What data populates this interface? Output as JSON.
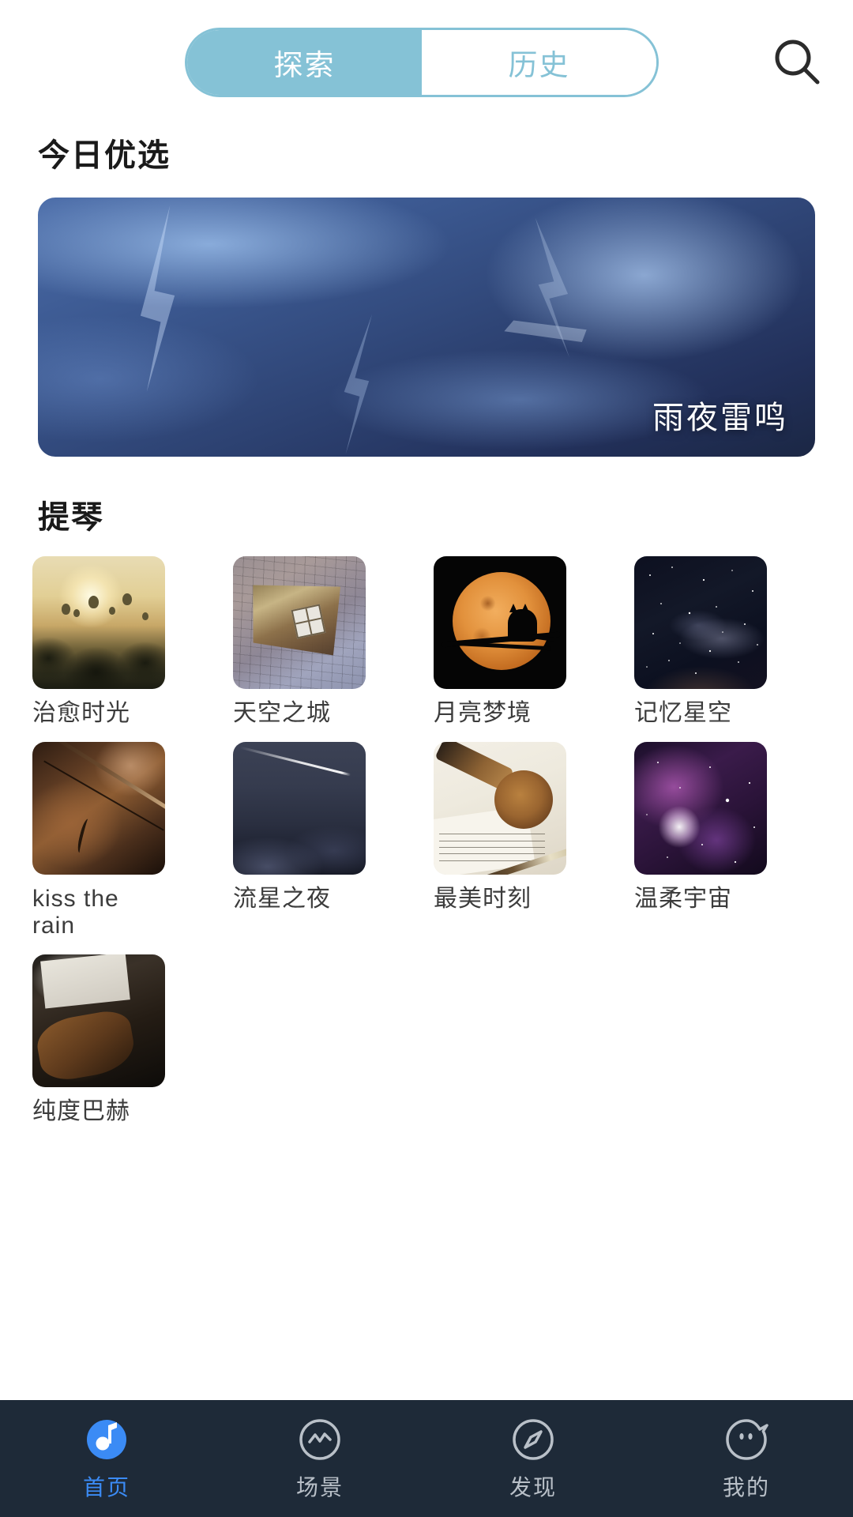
{
  "header": {
    "tabs": [
      {
        "label": "探索",
        "active": true
      },
      {
        "label": "历史",
        "active": false
      }
    ],
    "search_icon": "search-icon",
    "accent_color": "#85c2d6"
  },
  "sections": {
    "today": {
      "title": "今日优选",
      "featured": {
        "label": "雨夜雷鸣",
        "art": "stormy-night-lightning"
      }
    },
    "violin": {
      "title": "提琴",
      "items": [
        {
          "label": "治愈时光",
          "art": "sunrise-balloons"
        },
        {
          "label": "天空之城",
          "art": "puddle-reflection"
        },
        {
          "label": "月亮梦境",
          "art": "moon-cat"
        },
        {
          "label": "记忆星空",
          "art": "milky-way"
        },
        {
          "label": "kiss the rain",
          "art": "violin-player"
        },
        {
          "label": "流星之夜",
          "art": "meteor-night"
        },
        {
          "label": "最美时刻",
          "art": "violin-scroll-sheet"
        },
        {
          "label": "温柔宇宙",
          "art": "purple-nebula"
        },
        {
          "label": "纯度巴赫",
          "art": "violin-sheet-dark"
        }
      ]
    }
  },
  "bottom_nav": {
    "active_color": "#3b8bf5",
    "inactive_color": "#b9c0c8",
    "background": "#1e2a38",
    "items": [
      {
        "label": "首页",
        "icon": "music-note-icon",
        "active": true
      },
      {
        "label": "场景",
        "icon": "wave-circle-icon",
        "active": false
      },
      {
        "label": "发现",
        "icon": "compass-icon",
        "active": false
      },
      {
        "label": "我的",
        "icon": "profile-face-icon",
        "active": false
      }
    ]
  }
}
